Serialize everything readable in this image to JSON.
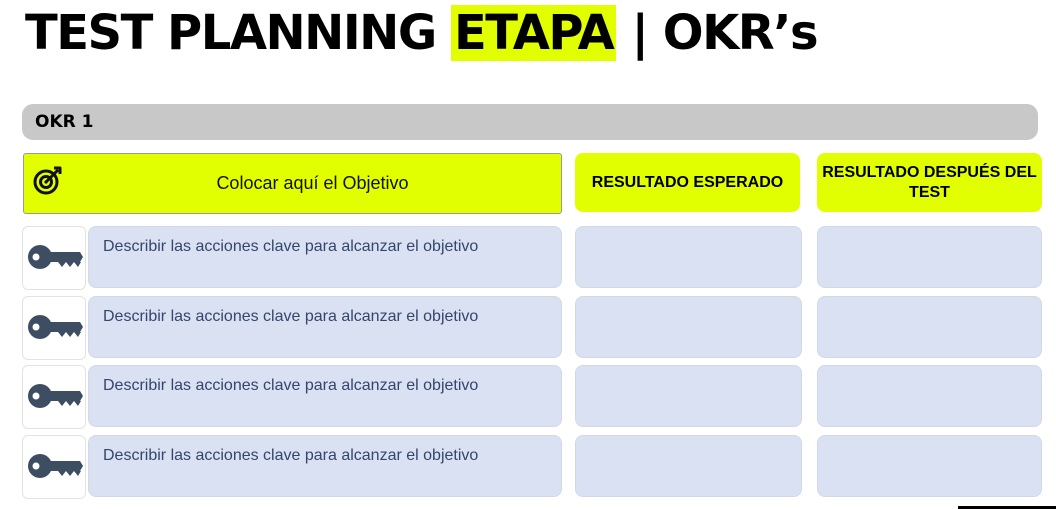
{
  "title": {
    "part1": "TEST PLANNING ",
    "highlight": "ETAPA",
    "part2": " | OKR’s"
  },
  "okr_label": "OKR 1",
  "objective": {
    "icon": "target-icon",
    "text": "Colocar aquí el Objetivo"
  },
  "headers": {
    "expected": "RESULTADO ESPERADO",
    "after_test": "RESULTADO DESPUÉS DEL TEST"
  },
  "key_results": [
    {
      "icon": "key-icon",
      "text": "Describir las acciones clave para alcanzar el objetivo"
    },
    {
      "icon": "key-icon",
      "text": "Describir las acciones clave para alcanzar el objetivo"
    },
    {
      "icon": "key-icon",
      "text": "Describir las acciones clave para alcanzar el objetivo"
    },
    {
      "icon": "key-icon",
      "text": "Describir las acciones clave para alcanzar el objetivo"
    }
  ],
  "colors": {
    "accent": "#e2ff00",
    "row_bg": "#d9e1f2",
    "bar_bg": "#c8c8c8",
    "icon": "#3d4e63"
  }
}
